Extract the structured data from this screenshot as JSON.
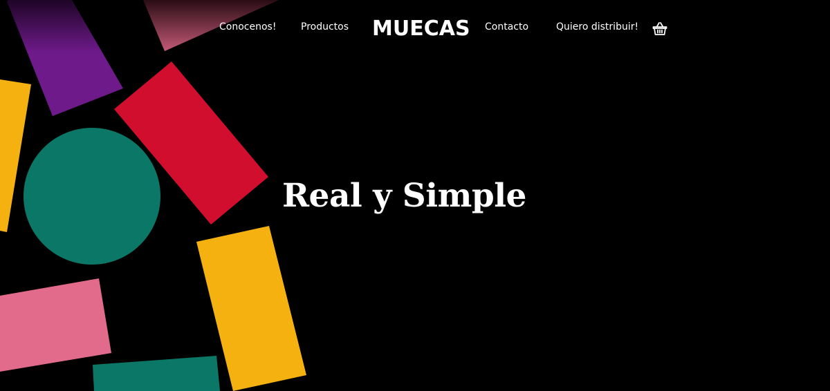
{
  "brand": {
    "logo_text": "MUECAS"
  },
  "nav": {
    "items": [
      {
        "label": "Conocenos!"
      },
      {
        "label": "Productos"
      },
      {
        "label": "Contacto"
      },
      {
        "label": "Quiero distribuir!"
      }
    ],
    "cart_icon": "basket-icon"
  },
  "hero": {
    "headline": "Real y Simple"
  },
  "colors": {
    "background": "#000000",
    "text": "#ffffff",
    "purple": "#6e1a8a",
    "red": "#d10e2e",
    "green": "#0b7767",
    "yellow": "#f5b10f",
    "pink": "#e26a8b",
    "rose": "#b8546e"
  }
}
